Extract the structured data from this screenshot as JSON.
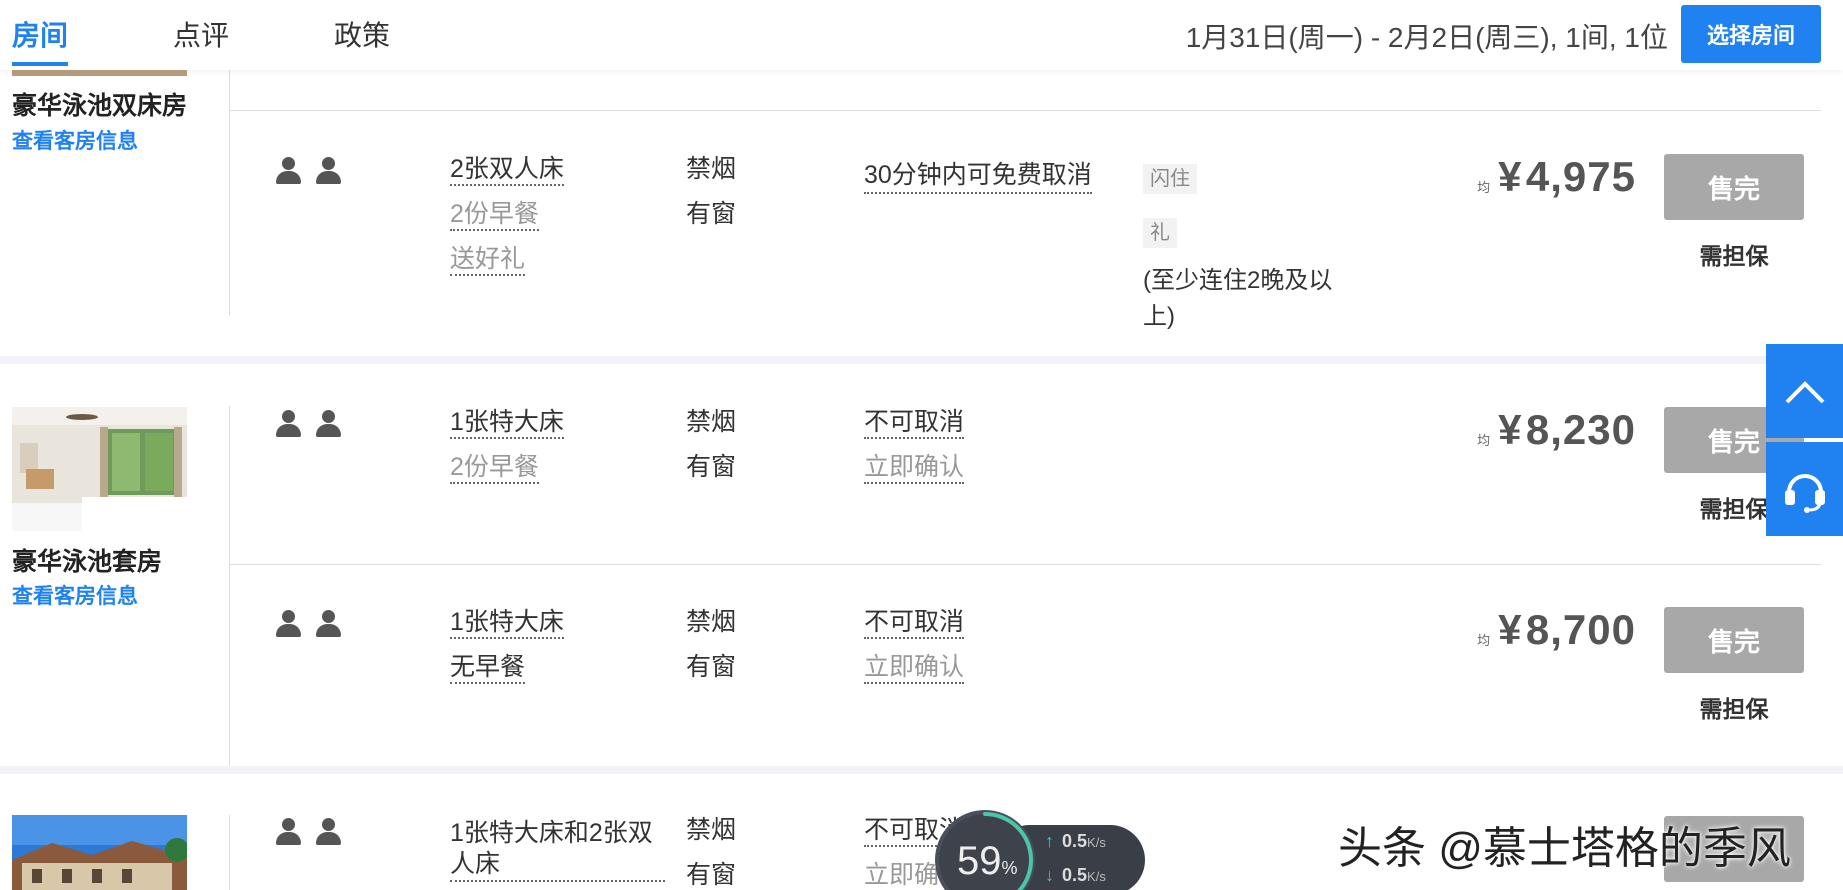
{
  "nav": {
    "tabs": [
      {
        "label": "房间"
      },
      {
        "label": "点评"
      },
      {
        "label": "政策"
      }
    ],
    "dates": "1月31日(周一) - 2月2日(周三), 1间, 1位",
    "select_button": "选择房间"
  },
  "colors": {
    "accent": "#1f82f0",
    "sold_out": "#a8a8a8"
  },
  "rooms": [
    {
      "name": "豪华泳池双床房",
      "link": "查看客房信息",
      "rates": [
        {
          "bed": "2张双人床",
          "meal": "2份早餐",
          "gift": "送好礼",
          "smoking": "禁烟",
          "window": "有窗",
          "policy": "30分钟内可免费取消",
          "tags": [
            "闪住",
            "礼"
          ],
          "note": "(至少连住2晚及以上)",
          "avg_label": "均",
          "currency": "¥",
          "price": "4,975",
          "status": "售完",
          "guarantee": "需担保"
        }
      ]
    },
    {
      "name": "豪华泳池套房",
      "link": "查看客房信息",
      "rates": [
        {
          "bed": "1张特大床",
          "meal": "2份早餐",
          "smoking": "禁烟",
          "window": "有窗",
          "policy": "不可取消",
          "confirm": "立即确认",
          "avg_label": "均",
          "currency": "¥",
          "price": "8,230",
          "status": "售完",
          "guarantee": "需担保"
        },
        {
          "bed": "1张特大床",
          "meal": "无早餐",
          "smoking": "禁烟",
          "window": "有窗",
          "policy": "不可取消",
          "confirm": "立即确认",
          "avg_label": "均",
          "currency": "¥",
          "price": "8,700",
          "status": "售完",
          "guarantee": "需担保"
        }
      ]
    },
    {
      "rates": [
        {
          "bed": "1张特大床和2张双人床",
          "smoking": "禁烟",
          "window": "有窗",
          "policy": "不可取消",
          "confirm": "立即确认"
        }
      ]
    }
  ],
  "side_tools": {
    "top_icon": "chevron-up-icon",
    "support_icon": "headset-icon"
  },
  "net_widget": {
    "percent": "59",
    "percent_unit": "%",
    "up": "0.5",
    "down": "0.5",
    "unit": "K/s",
    "progress": 0.59
  },
  "watermark": "头条 @慕士塔格的季风"
}
